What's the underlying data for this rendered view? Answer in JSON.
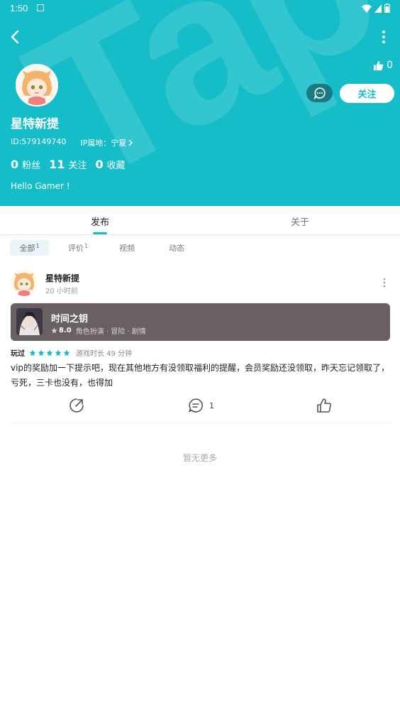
{
  "status_bar": {
    "time": "1:50"
  },
  "watermark": "TapTap",
  "header": {
    "like_count": "0",
    "follow_label": "关注",
    "username": "星特新提",
    "id_text": "ID:579149740",
    "ip_text": "IP属地：宁夏",
    "stats": [
      {
        "num": "0",
        "label": "粉丝"
      },
      {
        "num": "11",
        "label": "关注"
      },
      {
        "num": "0",
        "label": "收藏"
      }
    ],
    "bio": "Hello Gamer !"
  },
  "tabs": [
    {
      "label": "发布",
      "active": true
    },
    {
      "label": "关于",
      "active": false
    }
  ],
  "filters": [
    {
      "label": "全部",
      "count": "1",
      "active": true
    },
    {
      "label": "评价",
      "count": "1",
      "active": false
    },
    {
      "label": "视频",
      "count": "",
      "active": false
    },
    {
      "label": "动态",
      "count": "",
      "active": false
    }
  ],
  "post": {
    "author": "星特新提",
    "time": "20 小时前",
    "game": {
      "title": "时间之钥",
      "score": "8.0",
      "tags": "角色扮演 · 冒险 · 剧情"
    },
    "played_label": "玩过",
    "rating_stars": 5,
    "playtime": "游戏时长 49 分钟",
    "text": "vip的奖励加一下提示吧，现在其他地方有没领取福利的提醒，会员奖励还没领取，昨天忘记领取了，亏死，三卡也没有，也得加",
    "comment_count": "1"
  },
  "footer": {
    "no_more": "暂无更多"
  },
  "colors": {
    "accent": "#15bdc9",
    "card_bg": "#686063",
    "message_btn": "#1a7a83"
  }
}
